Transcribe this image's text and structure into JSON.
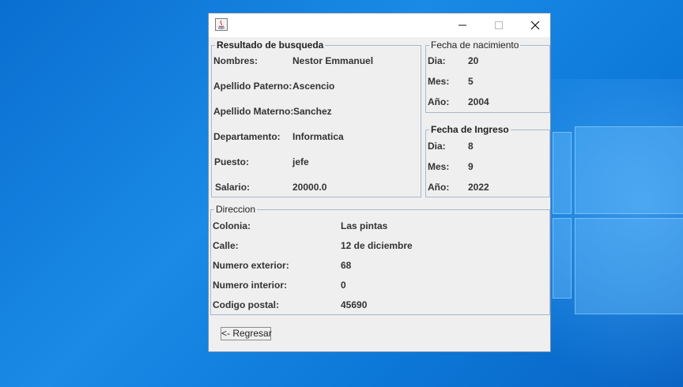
{
  "window": {
    "controls": {
      "minimize": "minimize-icon",
      "maximize": "maximize-icon",
      "close": "close-icon"
    }
  },
  "resultado": {
    "legend": "Resultado de busqueda",
    "rows": [
      {
        "label": "Nombres:",
        "value": "Nestor Emmanuel"
      },
      {
        "label": "Apellido Paterno:",
        "value": "Ascencio"
      },
      {
        "label": "Apellido Materno:",
        "value": "Sanchez"
      },
      {
        "label": "Departamento:",
        "value": "Informatica"
      },
      {
        "label": "Puesto:",
        "value": "jefe"
      },
      {
        "label": "Salario:",
        "value": "20000.0"
      }
    ]
  },
  "nacimiento": {
    "legend": "Fecha de nacimiento",
    "rows": [
      {
        "label": "Dia:",
        "value": "20"
      },
      {
        "label": "Mes:",
        "value": "5"
      },
      {
        "label": "Año:",
        "value": "2004"
      }
    ]
  },
  "ingreso": {
    "legend": "Fecha de Ingreso",
    "rows": [
      {
        "label": "Dia:",
        "value": "8"
      },
      {
        "label": "Mes:",
        "value": "9"
      },
      {
        "label": "Año:",
        "value": "2022"
      }
    ]
  },
  "direccion": {
    "legend": "Direccion",
    "rows": [
      {
        "label": "Colonia:",
        "value": "Las pintas"
      },
      {
        "label": "Calle:",
        "value": "12 de diciembre"
      },
      {
        "label": "Numero exterior:",
        "value": "68"
      },
      {
        "label": "Numero interior:",
        "value": "0"
      },
      {
        "label": "Codigo postal:",
        "value": "45690"
      }
    ]
  },
  "buttons": {
    "back": "<- Regresar"
  },
  "colors": {
    "desktop": "#0c78d8",
    "window_bg": "#efefef",
    "border": "#a9b9cc"
  }
}
